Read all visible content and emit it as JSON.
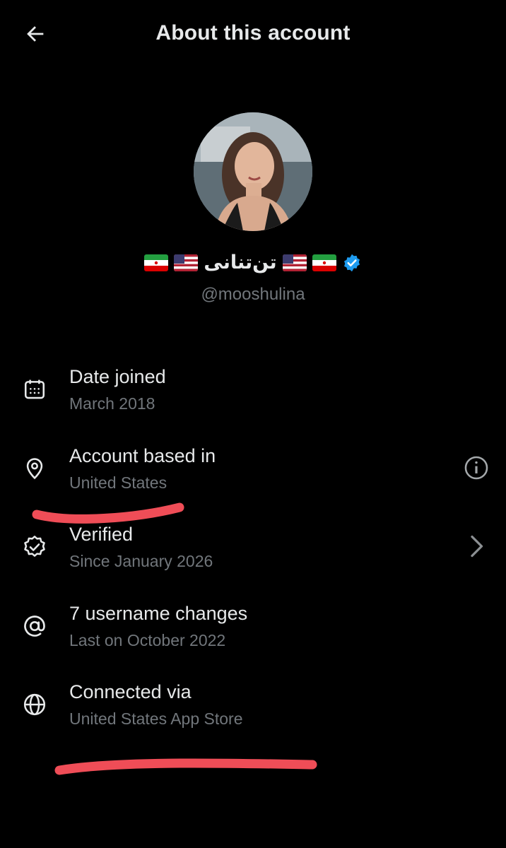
{
  "header": {
    "title": "About this account",
    "back_icon": "arrow-left-icon"
  },
  "profile": {
    "display_name_text": "تن‌تنانی",
    "flags": [
      "iran-flag",
      "usa-flag",
      "usa-flag",
      "iran-flag"
    ],
    "verified_badge": "verified-badge-icon",
    "badge_color": "#1d9bf0",
    "handle": "@mooshulina"
  },
  "details": [
    {
      "icon": "calendar-icon",
      "label": "Date joined",
      "value": "March 2018"
    },
    {
      "icon": "location-pin-icon",
      "label": "Account based in",
      "value": "United States",
      "trailing": "info-icon"
    },
    {
      "icon": "verified-check-icon",
      "label": "Verified",
      "value": "Since January 2026",
      "trailing": "chevron-right-icon"
    },
    {
      "icon": "at-sign-icon",
      "label": "7 username changes",
      "value": "Last on October 2022"
    },
    {
      "icon": "globe-icon",
      "label": "Connected via",
      "value": "United States App Store"
    }
  ],
  "colors": {
    "background": "#000000",
    "primary_text": "#e7e9ea",
    "secondary_text": "#71767b",
    "annotation": "#ef4d57"
  }
}
